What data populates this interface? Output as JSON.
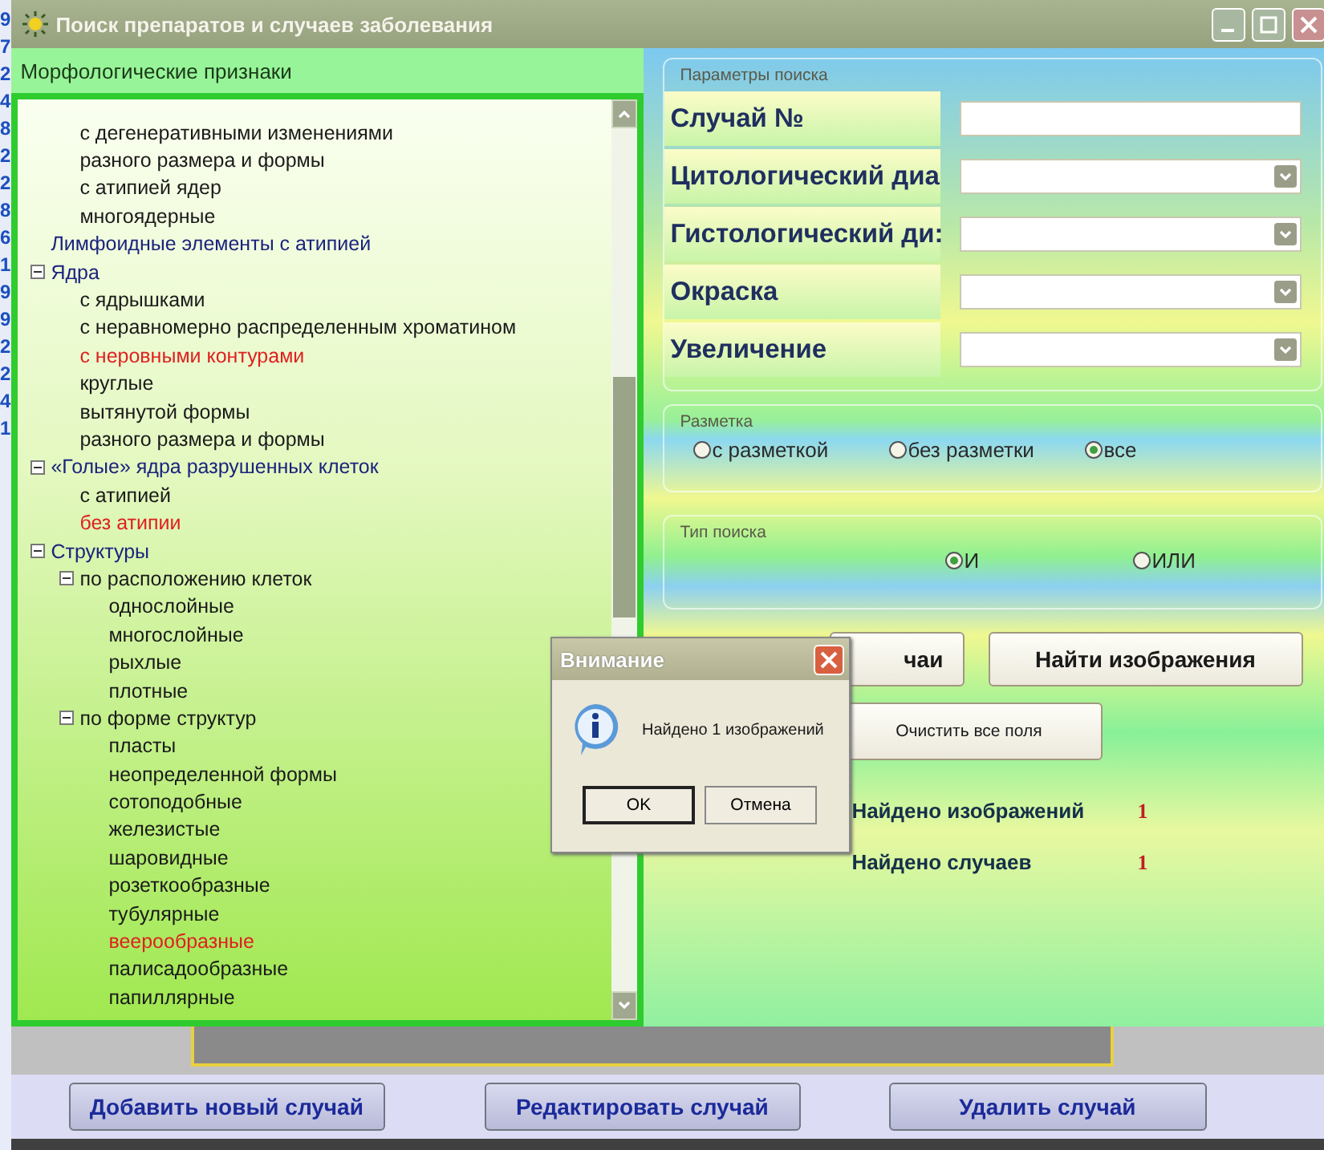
{
  "background_window": {
    "digits": [
      "9",
      "7",
      "2",
      "4",
      "8",
      "2",
      "2",
      "8",
      "6",
      "1",
      "9",
      "9",
      "2",
      "2",
      "4",
      "1"
    ]
  },
  "window": {
    "title": "Поиск препаратов и случаев заболевания"
  },
  "morphology": {
    "header": "Морфологические признаки",
    "tree": [
      {
        "children": [
          {
            "label": "с дегенеративными изменениями",
            "color": "#1a1a1a"
          },
          {
            "label": "разного размера и формы",
            "color": "#1a1a1a"
          },
          {
            "label": "с атипией ядер",
            "color": "#1a1a1a"
          },
          {
            "label": "многоядерные",
            "color": "#1a1a1a"
          }
        ]
      },
      {
        "label": "Лимфоидные элементы с атипией",
        "color": "#1a237e"
      },
      {
        "label": "Ядра",
        "color": "#1a237e",
        "expanded": true,
        "children": [
          {
            "label": "с ядрышками",
            "color": "#1a1a1a"
          },
          {
            "label": "с неравномерно распределенным хроматином",
            "color": "#1a1a1a"
          },
          {
            "label": "с неровными контурами",
            "color": "#e02020"
          },
          {
            "label": "круглые",
            "color": "#1a1a1a"
          },
          {
            "label": "вытянутой  формы",
            "color": "#1a1a1a"
          },
          {
            "label": "разного  размера и формы",
            "color": "#1a1a1a"
          }
        ]
      },
      {
        "label": "«Голые» ядра разрушенных клеток",
        "color": "#1a237e",
        "expanded": true,
        "children": [
          {
            "label": "с атипией",
            "color": "#1a1a1a"
          },
          {
            "label": "без атипии",
            "color": "#e02020"
          }
        ]
      },
      {
        "label": "Структуры",
        "color": "#1a237e",
        "expanded": true,
        "children": [
          {
            "label": "по расположению клеток",
            "color": "#1a1a1a",
            "expanded": true,
            "children": [
              {
                "label": "однослойные",
                "color": "#1a1a1a"
              },
              {
                "label": "многослойные",
                "color": "#1a1a1a"
              },
              {
                "label": "рыхлые",
                "color": "#1a1a1a"
              },
              {
                "label": "плотные",
                "color": "#1a1a1a"
              }
            ]
          },
          {
            "label": "по форме структур",
            "color": "#1a1a1a",
            "expanded": true,
            "children": [
              {
                "label": "пласты",
                "color": "#1a1a1a"
              },
              {
                "label": "неопределенной формы",
                "color": "#1a1a1a"
              },
              {
                "label": "сотоподобные",
                "color": "#1a1a1a"
              },
              {
                "label": "железистые",
                "color": "#1a1a1a"
              },
              {
                "label": "шаровидные",
                "color": "#1a1a1a"
              },
              {
                "label": "розеткообразные",
                "color": "#1a1a1a"
              },
              {
                "label": "тубулярные",
                "color": "#1a1a1a"
              },
              {
                "label": "веерообразные",
                "color": "#e02020"
              },
              {
                "label": "палисадообразные",
                "color": "#1a1a1a"
              },
              {
                "label": "папиллярные",
                "color": "#1a1a1a"
              }
            ]
          }
        ]
      }
    ]
  },
  "search_params": {
    "legend": "Параметры поиска",
    "fields": [
      {
        "label": "Случай №",
        "kind": "text"
      },
      {
        "label": "Цитологический диа",
        "kind": "dropdown"
      },
      {
        "label": "Гистологический ди:",
        "kind": "dropdown"
      },
      {
        "label": "Окраска",
        "kind": "dropdown"
      },
      {
        "label": "Увеличение",
        "kind": "dropdown"
      }
    ]
  },
  "markup": {
    "legend": "Разметка",
    "options": [
      {
        "label": "с разметкой",
        "selected": false
      },
      {
        "label": "без разметки",
        "selected": false
      },
      {
        "label": "все",
        "selected": true
      }
    ]
  },
  "search_type": {
    "legend": "Тип поиска",
    "options": [
      {
        "label": "И",
        "selected": true
      },
      {
        "label": "ИЛИ",
        "selected": false
      }
    ]
  },
  "actions": {
    "find_cases": "чаи",
    "find_images": "Найти изображения",
    "clear": "Очистить все поля"
  },
  "results": [
    {
      "label": "Найдено изображений",
      "value": "1"
    },
    {
      "label": "Найдено случаев",
      "value": "1"
    }
  ],
  "dialog": {
    "title": "Внимание",
    "message": "Найдено 1 изображений",
    "buttons": [
      "OK",
      "Отмена"
    ]
  },
  "bottom_buttons": [
    "Добавить новый случай",
    "Редактировать случай",
    "Удалить случай"
  ]
}
